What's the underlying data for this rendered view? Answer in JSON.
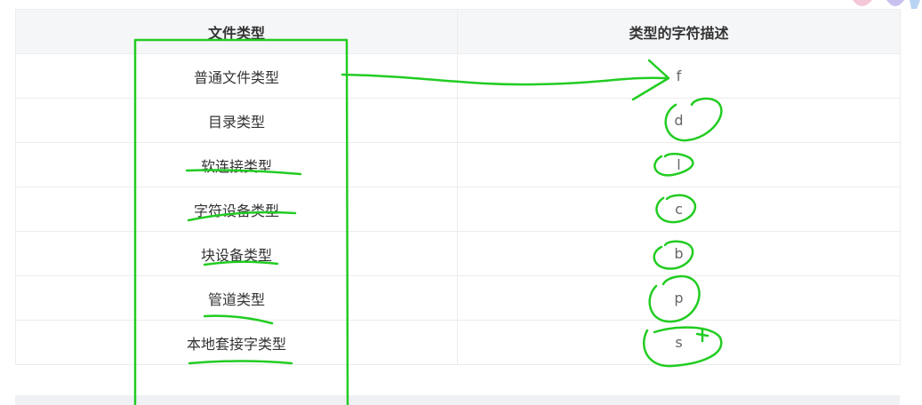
{
  "table": {
    "headers": [
      "文件类型",
      "类型的字符描述"
    ],
    "rows": [
      {
        "type": "普通文件类型",
        "desc": "f"
      },
      {
        "type": "目录类型",
        "desc": "d"
      },
      {
        "type": "软连接类型",
        "desc": "l"
      },
      {
        "type": "字符设备类型",
        "desc": "c"
      },
      {
        "type": "块设备类型",
        "desc": "b"
      },
      {
        "type": "管道类型",
        "desc": "p"
      },
      {
        "type": "本地套接字类型",
        "desc": "s"
      }
    ]
  },
  "annotation": {
    "color": "#22cc22"
  }
}
